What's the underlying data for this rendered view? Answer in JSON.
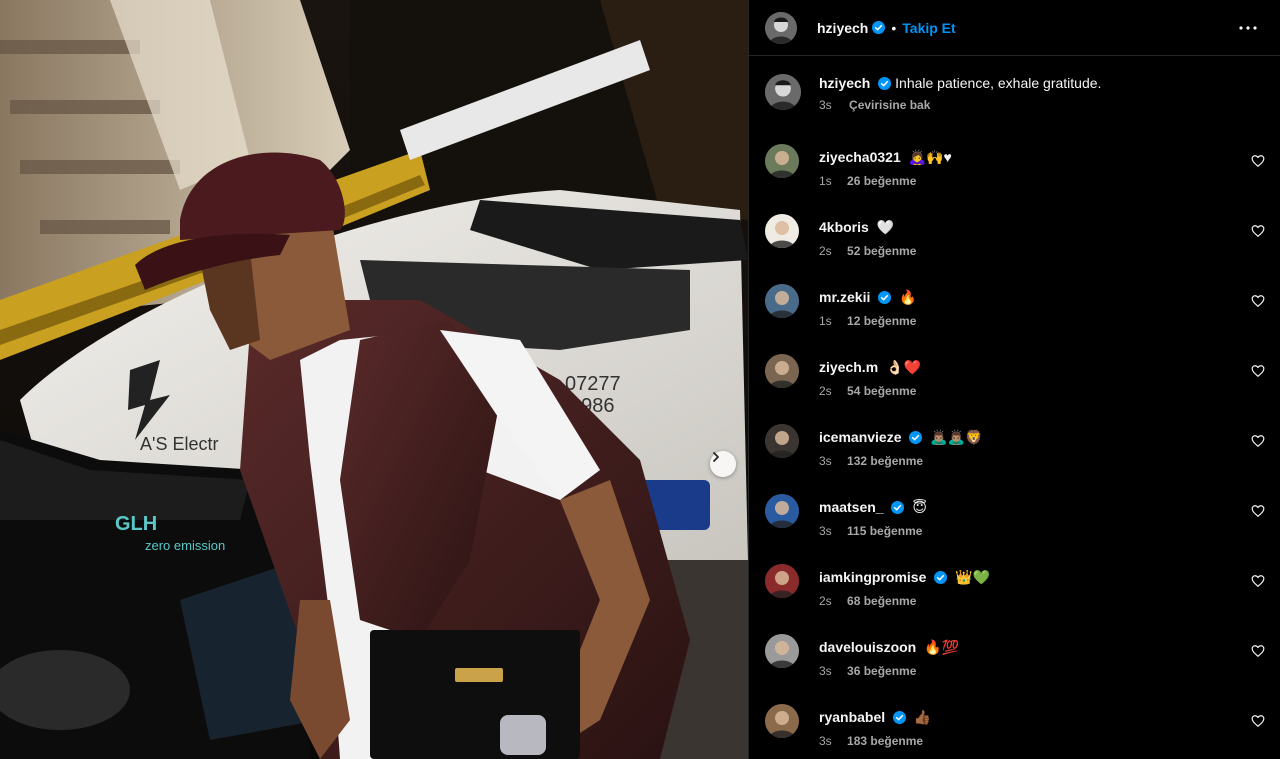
{
  "header": {
    "username": "hziyech",
    "separator": "•",
    "follow_label": "Takip Et",
    "more_icon": "more-horizontal-icon"
  },
  "caption": {
    "username": "hziyech",
    "text": "Inhale patience, exhale gratitude.",
    "time": "3s",
    "see_translation": "Çevirisine bak"
  },
  "comments": [
    {
      "username": "ziyecha0321",
      "verified": false,
      "text": "🙇‍♀️🙌♥",
      "time": "1s",
      "likes": "26 beğenme",
      "avatar_color": "#6b7a5a"
    },
    {
      "username": "4kboris",
      "verified": false,
      "text": "🤍",
      "time": "2s",
      "likes": "52 beğenme",
      "avatar_color": "#f0ece4"
    },
    {
      "username": "mr.zekii",
      "verified": true,
      "text": "🔥",
      "time": "1s",
      "likes": "12 beğenme",
      "avatar_color": "#4a6a8a"
    },
    {
      "username": "ziyech.m",
      "verified": false,
      "text": "👌🏻❤️",
      "time": "2s",
      "likes": "54 beğenme",
      "avatar_color": "#7a6550"
    },
    {
      "username": "icemanvieze",
      "verified": true,
      "text": "🙇🏽‍♂️🙇🏽‍♂️🦁",
      "time": "3s",
      "likes": "132 beğenme",
      "avatar_color": "#3a3530"
    },
    {
      "username": "maatsen_",
      "verified": true,
      "text": "😇",
      "time": "3s",
      "likes": "115 beğenme",
      "avatar_color": "#2a5aa0"
    },
    {
      "username": "iamkingpromise",
      "verified": true,
      "text": "👑💚",
      "time": "2s",
      "likes": "68 beğenme",
      "avatar_color": "#8a2a2a"
    },
    {
      "username": "davelouiszoon",
      "verified": false,
      "text": "🔥💯",
      "time": "3s",
      "likes": "36 beğenme",
      "avatar_color": "#9a9a9a"
    },
    {
      "username": "ryanbabel",
      "verified": true,
      "text": "👍🏾",
      "time": "3s",
      "likes": "183 beğenme",
      "avatar_color": "#8a6a4a"
    }
  ],
  "colors": {
    "accent": "#0095f6",
    "muted": "#a8a8a8",
    "background": "#000000"
  }
}
